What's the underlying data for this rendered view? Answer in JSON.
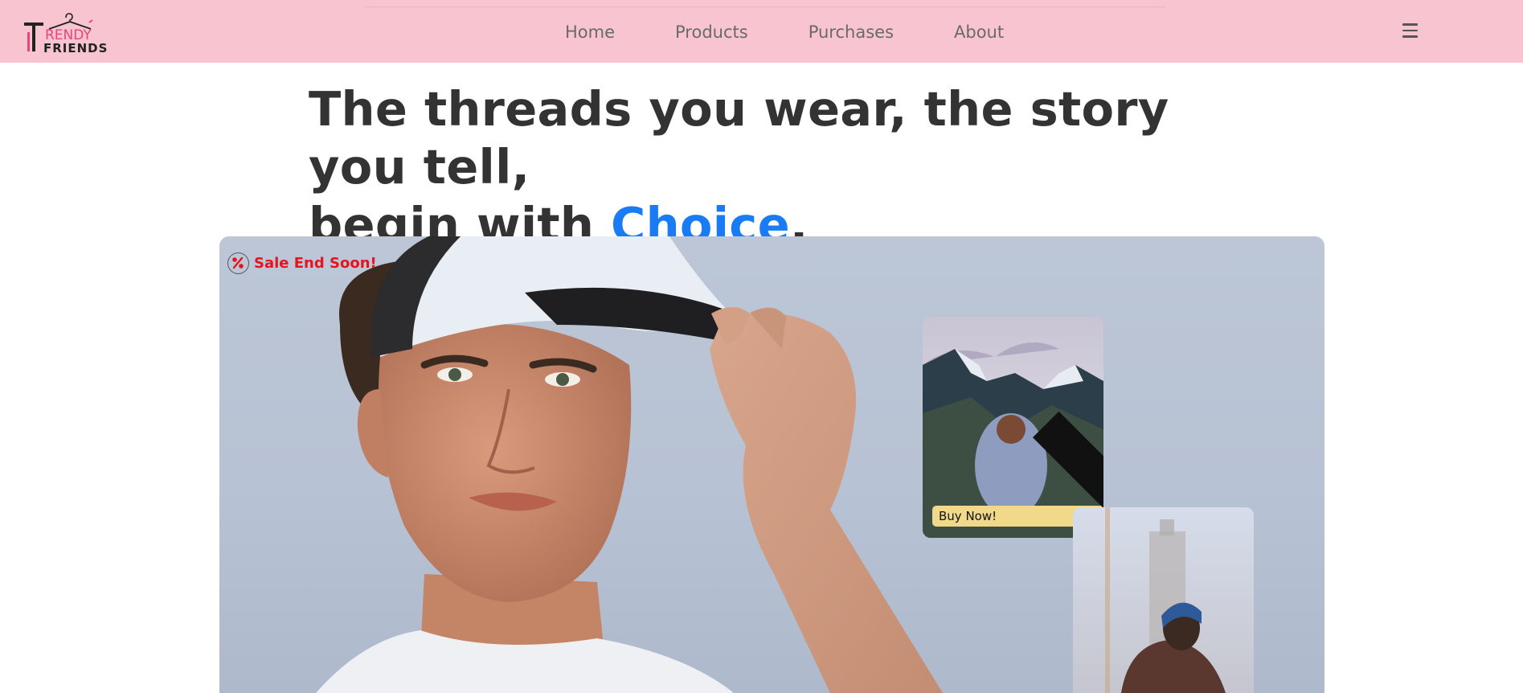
{
  "brand": {
    "line1": "TRENDY",
    "line2": "FRIENDS"
  },
  "nav": {
    "items": [
      "Home",
      "Products",
      "Purchases",
      "About"
    ]
  },
  "menu_icon": "hamburger-menu-icon",
  "headline": {
    "line1": "The threads you wear, the story you tell,",
    "line2_prefix": "begin with ",
    "accent_word": "Choice",
    "line2_suffix": "."
  },
  "hero": {
    "sale_text": "Sale End Soon!",
    "sale_icon": "percent-icon",
    "buy_button": "Buy Now!",
    "buy_icon": "chevron-right-icon"
  },
  "colors": {
    "navbar_bg": "#f7c4cf",
    "accent": "#1a7cf5",
    "sale_red": "#e6141c",
    "buy_button_bg": "#f2d98a",
    "logo_pink": "#e8457a"
  }
}
